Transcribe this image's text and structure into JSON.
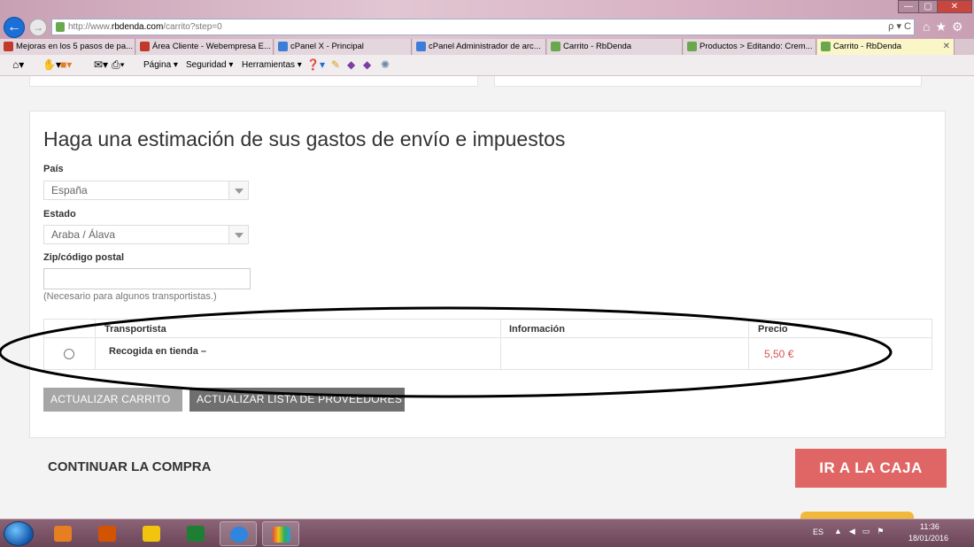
{
  "browser": {
    "url_prefix": "http://www.",
    "url_host": "rbdenda.com",
    "url_path": "/carrito?step=0",
    "address_tools": "ρ ▾ C",
    "tabs": [
      {
        "label": "Mejoras en los 5 pasos de pa...",
        "icon_color": "#c0392b"
      },
      {
        "label": "Área Cliente - Webempresa E...",
        "icon_color": "#c0392b"
      },
      {
        "label": "cPanel X - Principal",
        "icon_color": "#3b7dd8"
      },
      {
        "label": "cPanel Administrador de arc...",
        "icon_color": "#3b7dd8"
      },
      {
        "label": "Carrito - RbDenda",
        "icon_color": "#6aa84f"
      },
      {
        "label": "Productos > Editando: Crem...",
        "icon_color": "#6aa84f"
      },
      {
        "label": "Carrito - RbDenda",
        "icon_color": "#6aa84f"
      }
    ],
    "command_bar": {
      "page": "Página ▾",
      "security": "Seguridad ▾",
      "tools": "Herramientas ▾"
    }
  },
  "shipping_estimate": {
    "title": "Haga una estimación de sus gastos de envío e impuestos",
    "country_label": "País",
    "country_value": "España",
    "state_label": "Estado",
    "state_value": "Araba / Álava",
    "zip_label": "Zip/código postal",
    "zip_value": "",
    "zip_help": "(Necesario para algunos transportistas.)",
    "table": {
      "headers": [
        "Transportista",
        "Información",
        "Precio"
      ],
      "rows": [
        {
          "carrier": "Recogida en tienda –",
          "info": "",
          "price": "5,50 €",
          "selected": false
        }
      ]
    },
    "update_cart_button": "ACTUALIZAR CARRITO",
    "update_carriers_button": "ACTUALIZAR LISTA DE PROVEEDORES"
  },
  "footer_actions": {
    "continue_label": "CONTINUAR LA COMPRA",
    "checkout_label": "IR A LA CAJA"
  },
  "taskbar": {
    "language": "ES",
    "time": "11:36",
    "date": "18/01/2016"
  },
  "colors": {
    "checkout": "#e06666",
    "price": "#d9534f",
    "annotation": "#000000"
  }
}
